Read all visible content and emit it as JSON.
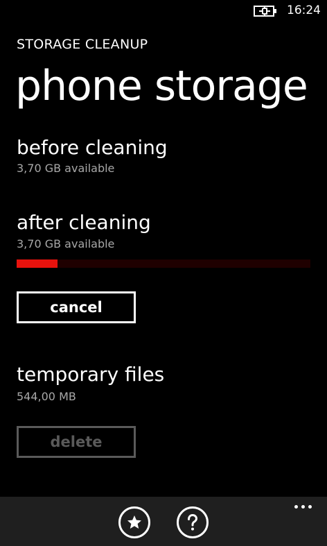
{
  "status_bar": {
    "time": "16:24",
    "battery_icon": "battery-charging-icon"
  },
  "header": {
    "app_title": "STORAGE CLEANUP",
    "page_title": "phone storage"
  },
  "before_cleaning": {
    "heading": "before cleaning",
    "available": "3,70 GB available"
  },
  "after_cleaning": {
    "heading": "after cleaning",
    "available": "3,70 GB available",
    "progress_fraction": 0.14,
    "progress_color": "#e8120d",
    "progress_track_color": "#1f0000"
  },
  "actions": {
    "cancel_label": "cancel",
    "delete_label": "delete"
  },
  "temporary_files": {
    "heading": "temporary files",
    "size": "544,00 MB"
  },
  "app_bar": {
    "buttons": [
      {
        "icon": "star-icon"
      },
      {
        "icon": "help-icon"
      }
    ],
    "more_icon": "more-dots-icon"
  }
}
